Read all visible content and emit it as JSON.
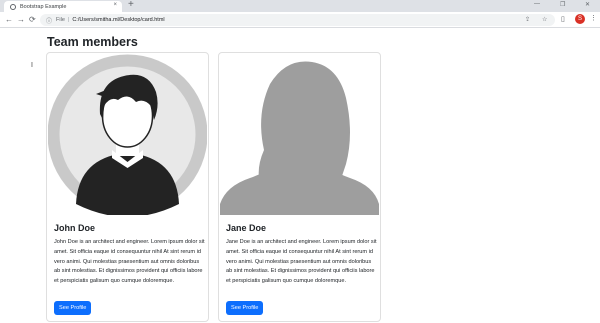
{
  "browser": {
    "tab_title": "Bootstrap Example",
    "tab_close": "×",
    "new_tab": "+",
    "window_controls": [
      "—",
      "❐",
      "✕"
    ],
    "nav_buttons": [
      "←",
      "→",
      "⟳"
    ],
    "url_scheme": "File",
    "url_separator": "|",
    "url_path": "C:/Users/smitha.ml/Desktop/card.html",
    "profile_initial": "S",
    "menu": "⋮"
  },
  "page": {
    "heading": "Team members",
    "cursor": "I"
  },
  "cards": [
    {
      "name": "John Doe",
      "text": "John Doe is an architect and engineer. Lorem ipsum dolor sit amet. Sit officia eaque id consequuntur nihil At sint rerum id vero animi. Qui molestias praesentium aut omnis doloribus ab sint molestias. Et dignissimos provident qui officiis labore et perspiciatis galisum quo cumque doloremque.",
      "button": "See Profile",
      "image": "male-avatar-illustration"
    },
    {
      "name": "Jane Doe",
      "text": "Jane Doe is an architect and engineer. Lorem ipsum dolor sit amet. Sit officia eaque id consequuntur nihil At sint rerum id vero animi. Qui molestias praesentium aut omnis doloribus ab sint molestias. Et dignissimos provident qui officiis labore et perspiciatis galisum quo cumque doloremque.",
      "button": "See Profile",
      "image": "female-silhouette-illustration"
    }
  ],
  "colors": {
    "primary_button": "#0d6efd",
    "avatar_bg": "#c9c9c9",
    "silhouette": "#9e9e9e",
    "profile_badge": "#d93025"
  }
}
